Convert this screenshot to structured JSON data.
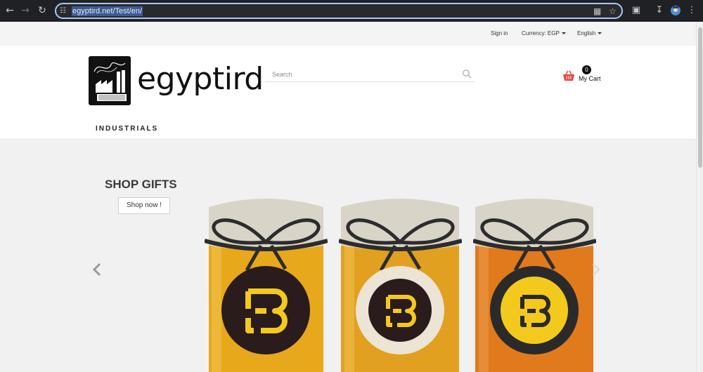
{
  "browser": {
    "url": "egyptird.net/Test/en/",
    "back_icon": "arrow-left-icon",
    "forward_icon": "arrow-right-icon",
    "reload_icon": "reload-icon"
  },
  "topbar": {
    "sign_in": "Sign in",
    "currency": "Currency: EGP",
    "language": "English"
  },
  "header": {
    "logo_text": "egyptird",
    "search_placeholder": "Search",
    "cart_count": "0",
    "cart_label": "My Cart"
  },
  "nav": {
    "industrials": "INDUSTRIALS"
  },
  "banner": {
    "title": "SHOP GIFTS",
    "button": "Shop now !",
    "jars": [
      {
        "honey": "#e8a81c",
        "outer": "#2a1b1c",
        "ring": "#2a1b1c",
        "mark": "#f4c91d"
      },
      {
        "honey": "#e2a020",
        "outer": "#ece4d4",
        "ring": "#2a1b1c",
        "mark": "#f4c91d"
      },
      {
        "honey": "#e07a1c",
        "outer": "#2a2a2a",
        "ring": "#f4c91d",
        "mark": "#2a2a2a"
      }
    ]
  },
  "colors": {
    "accent_cart": "#e6463c",
    "chrome_bg": "#202124",
    "page_bg": "#f1f1f1"
  }
}
